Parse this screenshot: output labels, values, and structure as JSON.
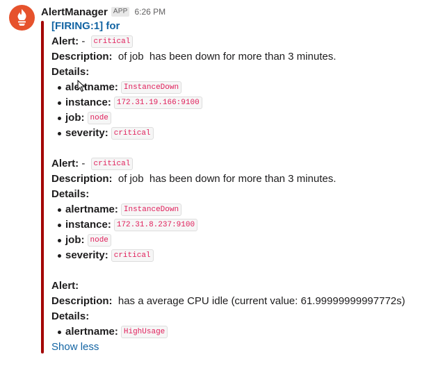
{
  "message": {
    "sender": "AlertManager",
    "app_badge": "APP",
    "time": "6:26 PM",
    "colors": {
      "attachment_bar": "#a30200",
      "link": "#1264a3",
      "code_text": "#e01e5a",
      "avatar_bg": "#e6522c"
    },
    "avatar_icon": "prometheus-logo-icon"
  },
  "attachment": {
    "title": "[FIRING:1]  for",
    "show_less": "Show less",
    "alerts": [
      {
        "alert_label": "Alert:",
        "alert_text": " - ",
        "alert_code": "critical",
        "description_label": "Description:",
        "description_text": "  of job  has been down for more than 3 minutes.",
        "details_label": "Details:",
        "details": [
          {
            "key": "alertname:",
            "value": "InstanceDown"
          },
          {
            "key": "instance:",
            "value": "172.31.19.166:9100"
          },
          {
            "key": "job:",
            "value": "node"
          },
          {
            "key": "severity:",
            "value": "critical"
          }
        ]
      },
      {
        "alert_label": "Alert:",
        "alert_text": " - ",
        "alert_code": "critical",
        "description_label": "Description:",
        "description_text": "  of job  has been down for more than 3 minutes.",
        "details_label": "Details:",
        "details": [
          {
            "key": "alertname:",
            "value": "InstanceDown"
          },
          {
            "key": "instance:",
            "value": "172.31.8.237:9100"
          },
          {
            "key": "job:",
            "value": "node"
          },
          {
            "key": "severity:",
            "value": "critical"
          }
        ]
      },
      {
        "alert_label": "Alert:",
        "description_label": "Description:",
        "description_text": "  has a average CPU idle (current value: 61.99999999997772s)",
        "details_label": "Details:",
        "details": [
          {
            "key": "alertname:",
            "value": "HighUsage"
          }
        ]
      }
    ]
  }
}
